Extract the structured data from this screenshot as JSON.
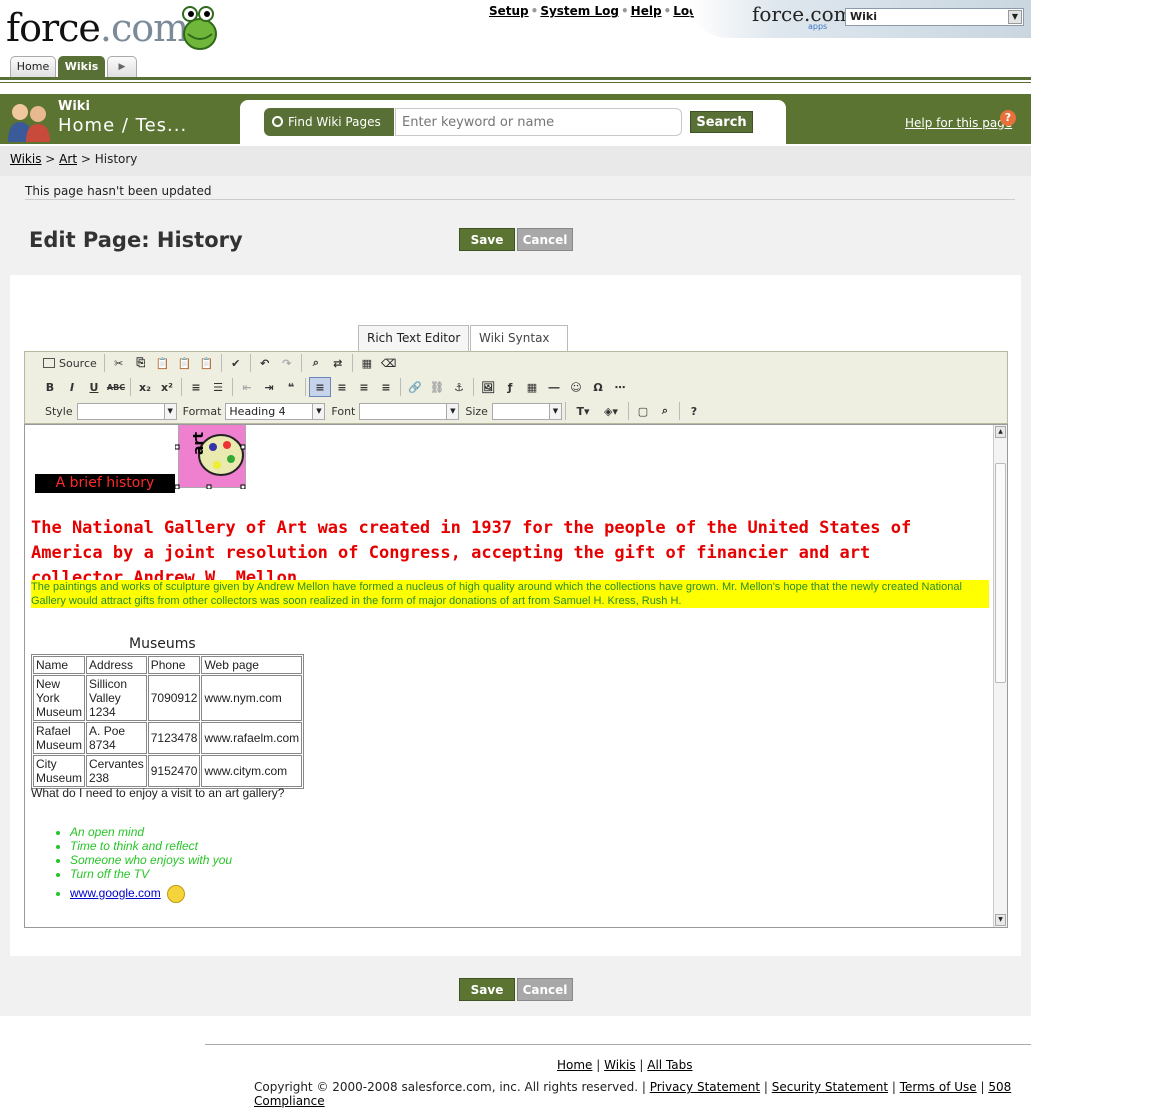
{
  "brand": {
    "logo_main": "force",
    "logo_suffix": ".com",
    "apps_logo": "force.com",
    "apps_sub": "apps"
  },
  "toplinks": [
    "Setup",
    "System Log",
    "Help",
    "Logout"
  ],
  "app_selector": {
    "value": "Wiki"
  },
  "tabs": {
    "home": "Home",
    "wikis": "Wikis"
  },
  "banner": {
    "small_title": "Wiki",
    "title": "Home / Tes...",
    "help_link": "Help for this page"
  },
  "search": {
    "find_label": "Find Wiki Pages",
    "placeholder": "Enter keyword or name",
    "button": "Search"
  },
  "breadcrumb": {
    "wikis": "Wikis",
    "art": "Art",
    "current": "History"
  },
  "notice": "This page hasn't been updated",
  "edit": {
    "title": "Edit Page: History",
    "save": "Save",
    "cancel": "Cancel"
  },
  "editor_tabs": {
    "rich": "Rich Text Editor",
    "wiki": "Wiki Syntax"
  },
  "toolbar": {
    "source": "Source",
    "style_label": "Style",
    "style_value": "",
    "format_label": "Format",
    "format_value": "Heading 4",
    "font_label": "Font",
    "font_value": "",
    "size_label": "Size",
    "size_value": ""
  },
  "content": {
    "brief": "A brief history",
    "art_text": "art",
    "heading": "The National Gallery of Art was created in 1937 for the people of the United States of America by a joint resolution of Congress, accepting the gift of financier and art collector Andrew W. Mellon.",
    "paragraph": "The paintings and works of sculpture given by Andrew Mellon have formed a nucleus of high quality around which the collections have grown. Mr. Mellon's hope that the newly created National Gallery would attract gifts from other collectors was soon realized in the form of major donations of art from Samuel H. Kress, Rush H.",
    "table_caption": "Museums",
    "table_headers": [
      "Name",
      "Address",
      "Phone",
      "Web page"
    ],
    "table_rows": [
      [
        "New York Museum",
        "Sillicon Valley 1234",
        "7090912",
        "www.nym.com"
      ],
      [
        "Rafael Museum",
        "A. Poe 8734",
        "7123478",
        "www.rafaelm.com"
      ],
      [
        "City Museum",
        "Cervantes 238",
        "9152470",
        "www.citym.com"
      ]
    ],
    "question": "What do I need to enjoy a visit to an art gallery?",
    "needs": [
      "An open mind",
      "Time to think and reflect",
      "Someone who enjoys with you",
      "Turn off the TV"
    ],
    "link": "www.google.com"
  },
  "footer": {
    "links": [
      "Home",
      "Wikis",
      "All Tabs"
    ],
    "copyright": "Copyright © 2000-2008 salesforce.com, inc. All rights reserved.",
    "legal": [
      "Privacy Statement",
      "Security Statement",
      "Terms of Use",
      "508 Compliance"
    ]
  },
  "colors": {
    "brand_green": "#5b7432",
    "heading_red": "#e60000",
    "highlight": "#ffff00",
    "list_green": "#27c527"
  }
}
